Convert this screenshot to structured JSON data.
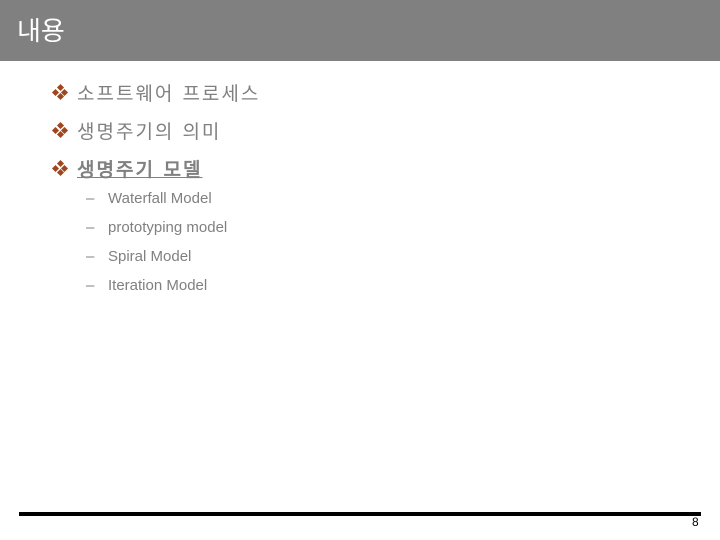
{
  "slide": {
    "title": "내용",
    "bullets": [
      {
        "label": "소프트웨어 프로세스",
        "active": false
      },
      {
        "label": "생명주기의 의미",
        "active": false
      },
      {
        "label": "생명주기 모델",
        "active": true
      }
    ],
    "sub_items": [
      {
        "dash": "–",
        "label": "Waterfall Model"
      },
      {
        "dash": "–",
        "label": "prototyping model"
      },
      {
        "dash": "–",
        "label": "Spiral Model"
      },
      {
        "dash": "–",
        "label": "Iteration Model"
      }
    ],
    "page_number": "8",
    "colors": {
      "title_bar": "#808080",
      "bullet": "#a0461e",
      "text": "#808080"
    }
  }
}
